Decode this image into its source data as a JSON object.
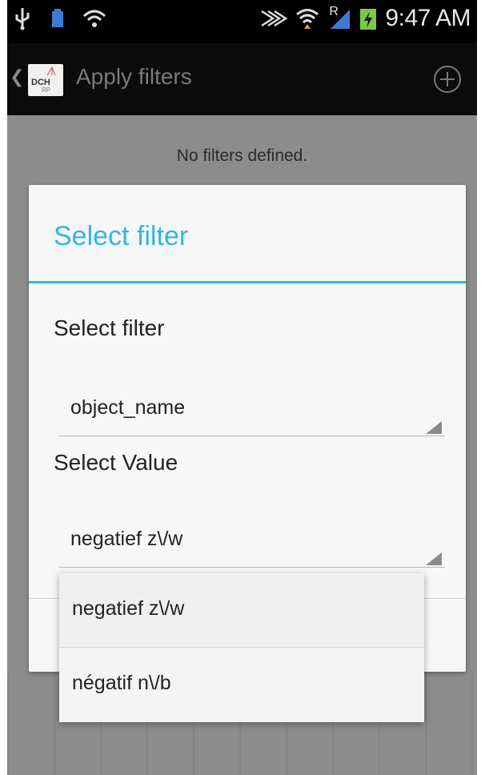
{
  "status_bar": {
    "time": "9:47 AM",
    "left_icons": [
      "usb-icon",
      "battery-full-icon",
      "wifi-sync-icon"
    ],
    "right_icons": [
      "nfc-icon",
      "wifi-icon",
      "signal-roaming-icon",
      "battery-charging-icon"
    ],
    "roaming_letter": "R"
  },
  "action_bar": {
    "title": "Apply filters",
    "logo_text": "DCH",
    "logo_subtext": "RP",
    "add_icon": "add-circle-icon",
    "back_icon": "chevron-left-icon"
  },
  "content": {
    "message": "No filters defined."
  },
  "dialog": {
    "title": "Select filter",
    "filter_label": "Select filter",
    "filter_value": "object_name",
    "value_label": "Select Value",
    "value_selected": "negatief z\\/w"
  },
  "dropdown": {
    "options": [
      "negatief z\\/w",
      "négatif n\\/b"
    ]
  },
  "colors": {
    "accent": "#33b5e5",
    "dim_background": "#8c8c8c",
    "dialog_background": "#f7f7f7"
  }
}
